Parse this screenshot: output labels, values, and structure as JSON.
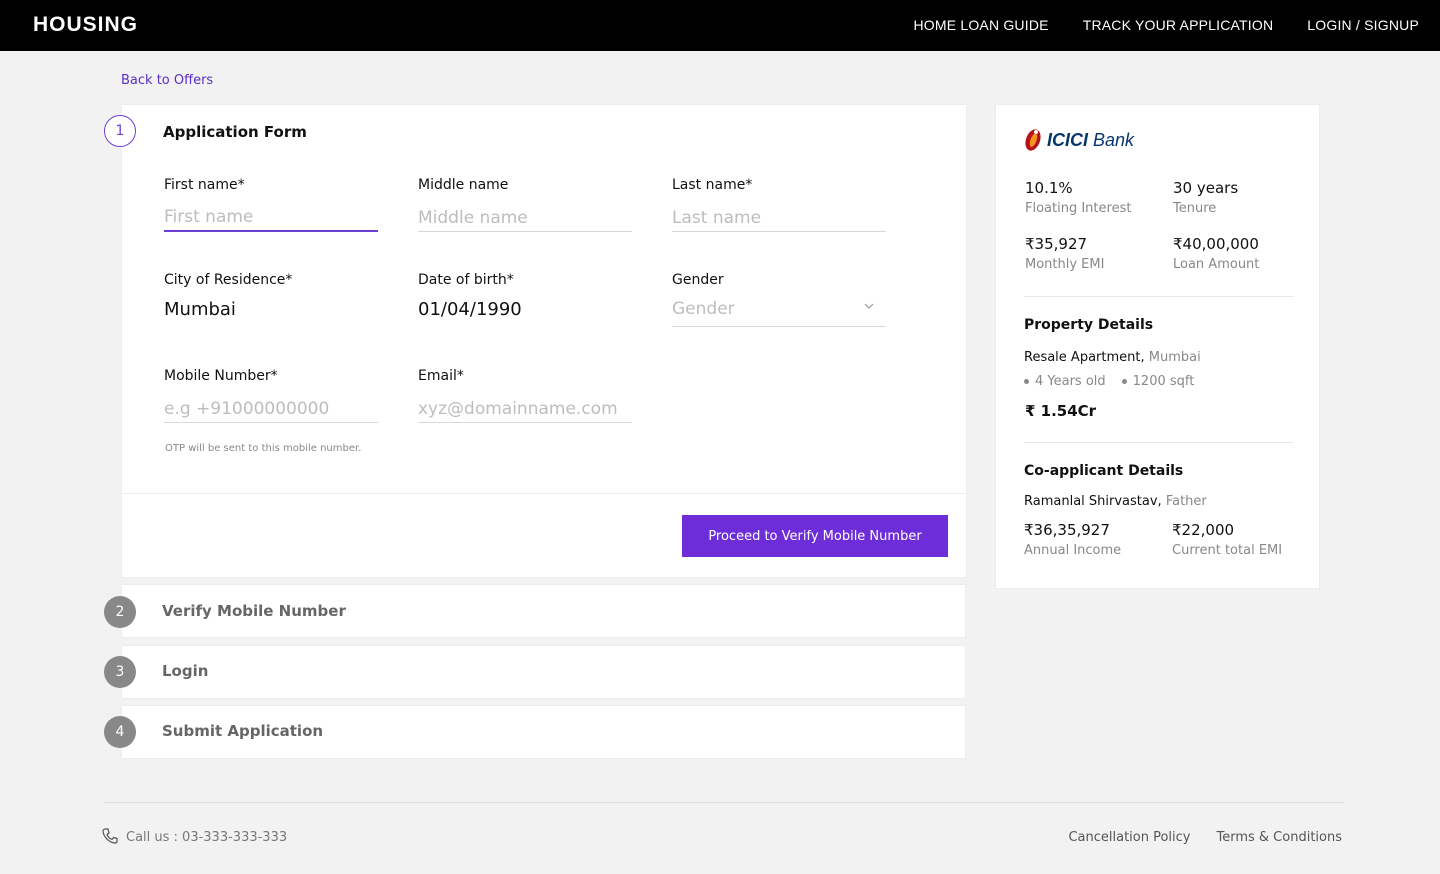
{
  "header": {
    "brand": "HOUSING",
    "nav": [
      "HOME LOAN GUIDE",
      "TRACK YOUR APPLICATION",
      "LOGIN / SIGNUP"
    ]
  },
  "back_link": "Back to Offers",
  "form": {
    "step_number": "1",
    "title": "Application Form",
    "first_name": {
      "label": "First name*",
      "placeholder": "First name"
    },
    "middle_name": {
      "label": "Middle name",
      "placeholder": "Middle name"
    },
    "last_name": {
      "label": "Last name*",
      "placeholder": "Last name"
    },
    "city": {
      "label": "City of Residence*",
      "value": "Mumbai"
    },
    "dob": {
      "label": "Date of birth*",
      "value": "01/04/1990"
    },
    "gender": {
      "label": "Gender",
      "placeholder": "Gender"
    },
    "mobile": {
      "label": "Mobile Number*",
      "placeholder": "e.g +91000000000",
      "hint": "OTP will be sent to this mobile number."
    },
    "email": {
      "label": "Email*",
      "placeholder": "xyz@domainname.com"
    },
    "submit_label": "Proceed to Verify Mobile Number"
  },
  "steps": [
    {
      "number": "2",
      "label": "Verify Mobile Number"
    },
    {
      "number": "3",
      "label": "Login"
    },
    {
      "number": "4",
      "label": "Submit Application"
    }
  ],
  "offer": {
    "bank_name_bold": "ICICI",
    "bank_name_rest": " Bank",
    "interest": {
      "value": "10.1%",
      "label": "Floating Interest"
    },
    "tenure": {
      "value": "30 years",
      "label": "Tenure"
    },
    "emi": {
      "value": "₹35,927",
      "label": "Monthly EMI"
    },
    "loan_amount": {
      "value": "₹40,00,000",
      "label": "Loan Amount"
    }
  },
  "property": {
    "title": "Property Details",
    "type": "Resale Apartment,",
    "city": " Mumbai",
    "age": "4 Years old",
    "area": "1200 sqft",
    "price": "₹ 1.54Cr"
  },
  "coapplicant": {
    "title": "Co-applicant Details",
    "name": "Ramanlal Shirvastav,",
    "relation": " Father",
    "income": {
      "value": "₹36,35,927",
      "label": "Annual Income"
    },
    "current_emi": {
      "value": "₹22,000",
      "label": "Current total EMI"
    }
  },
  "footer": {
    "call": "Call us : 03-333-333-333",
    "links": [
      "Cancellation Policy",
      "Terms & Conditions"
    ]
  },
  "colors": {
    "accent": "#6d2ed9",
    "topbar": "#000000",
    "background": "#f2f2f2"
  },
  "icons": [
    "phone-icon",
    "chevron-down-icon",
    "icici-logo-mark"
  ]
}
